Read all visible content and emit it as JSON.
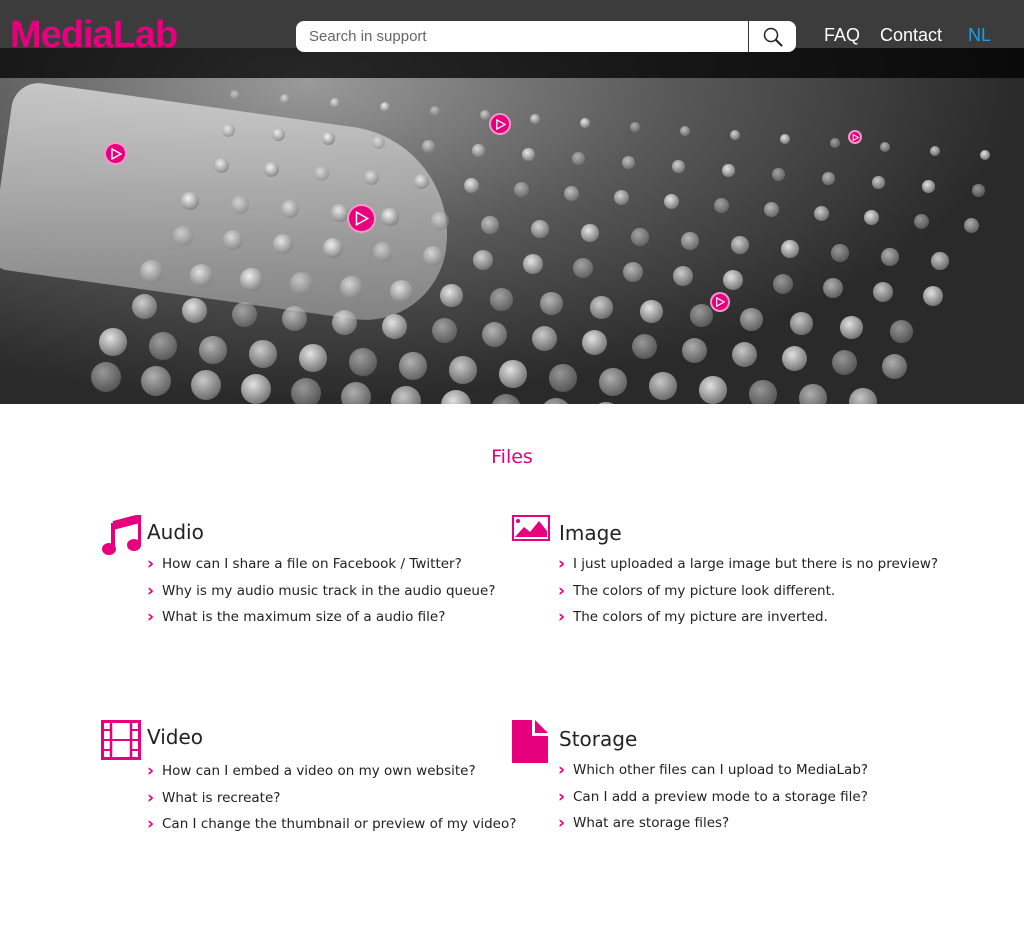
{
  "header": {
    "logo": "MediaLab",
    "search_placeholder": "Search in support",
    "nav": [
      "FAQ",
      "Contact",
      "NL"
    ]
  },
  "colors": {
    "accent": "#e6007e",
    "lang": "#1a9fe0",
    "header_bg": "#3c3c3c"
  },
  "section_title": "Files",
  "categories": [
    {
      "title": "Audio",
      "icon": "music-note-icon",
      "items": [
        "How can I share a file on Facebook / Twitter?",
        "Why is my audio music track in the audio queue?",
        "What is the maximum size of a audio file?"
      ]
    },
    {
      "title": "Image",
      "icon": "image-icon",
      "items": [
        "I just uploaded a large image but there is no preview?",
        "The colors of my picture look different.",
        "The colors of my picture are inverted."
      ]
    },
    {
      "title": "Video",
      "icon": "film-icon",
      "items": [
        "How can I embed a video on my own website?",
        "What is recreate?",
        "Can I change the thumbnail or preview of my video?"
      ]
    },
    {
      "title": "Storage",
      "icon": "file-icon",
      "items": [
        "Which other files can I upload to MediaLab?",
        "Can I add a preview mode to a storage file?",
        "What are storage files?"
      ]
    }
  ]
}
